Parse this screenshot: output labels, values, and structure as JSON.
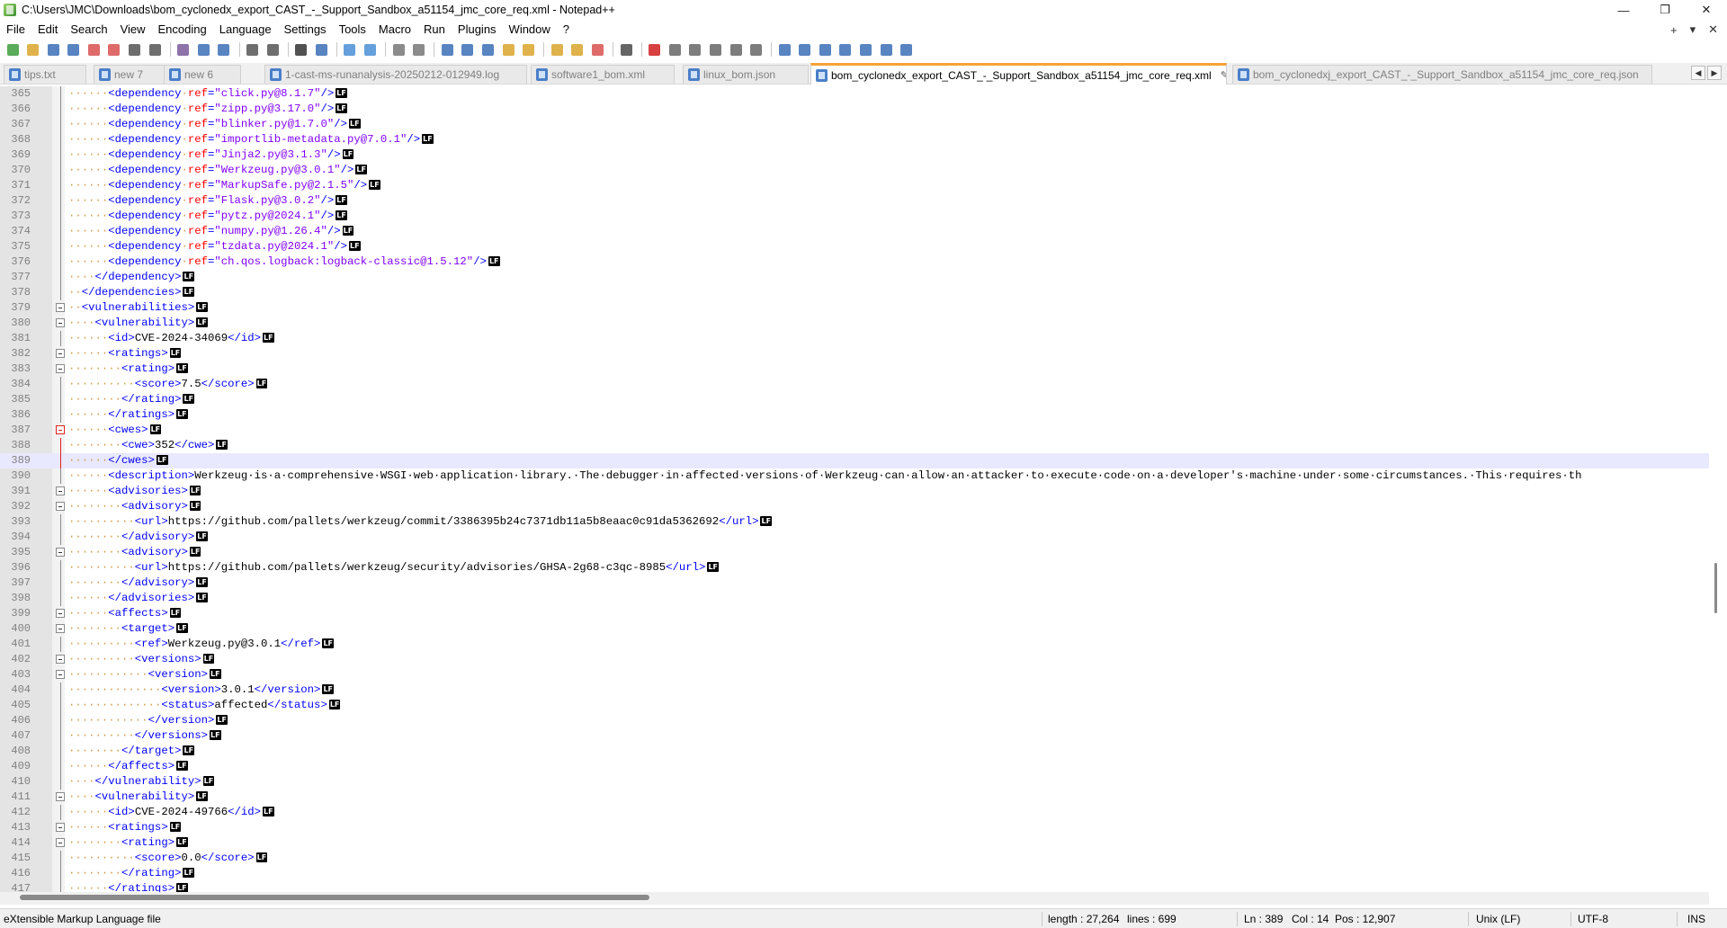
{
  "window": {
    "title": "C:\\Users\\JMC\\Downloads\\bom_cyclonedx_export_CAST_-_Support_Sandbox_a51154_jmc_core_req.xml - Notepad++",
    "minimize": "—",
    "maximize": "❐",
    "close": "✕"
  },
  "menu": {
    "items": [
      "File",
      "Edit",
      "Search",
      "View",
      "Encoding",
      "Language",
      "Settings",
      "Tools",
      "Macro",
      "Run",
      "Plugins",
      "Window",
      "?"
    ],
    "right_controls": [
      "+",
      "▾",
      "✕"
    ]
  },
  "toolbar": {
    "icons": [
      "new-file",
      "open-file",
      "save",
      "save-all",
      "close",
      "close-all",
      "print",
      "print-now",
      "cut",
      "copy",
      "paste",
      "undo",
      "redo",
      "find",
      "replace",
      "zoom-in",
      "zoom-out",
      "sync-vertical",
      "sync-horizontal",
      "word-wrap",
      "show-all-chars",
      "indent-guide",
      "udl",
      "doc-map",
      "function-list",
      "folder-as-workspace",
      "doc-switcher",
      "monitoring",
      "record-macro",
      "stop-record",
      "play-macro",
      "run-macro-multiple",
      "save-macro",
      "spell-check",
      "compare",
      "compare-prev",
      "compare-next",
      "compare-first",
      "compare-last",
      "compare-settings",
      "xml-tools"
    ]
  },
  "tabs": [
    {
      "label": "tips.txt",
      "active": false
    },
    {
      "label": "new 7",
      "active": false
    },
    {
      "label": "new 6",
      "active": false
    },
    {
      "label": "1-cast-ms-runanalysis-20250212-012949.log",
      "active": false
    },
    {
      "label": "software1_bom.xml",
      "active": false
    },
    {
      "label": "linux_bom.json",
      "active": false
    },
    {
      "label": "bom_cyclonedx_export_CAST_-_Support_Sandbox_a51154_jmc_core_req.xml",
      "active": true
    },
    {
      "label": "bom_cyclonedxj_export_CAST_-_Support_Sandbox_a51154_jmc_core_req.json",
      "active": false
    }
  ],
  "editor": {
    "current_line": 389,
    "lines": [
      {
        "n": 365,
        "fold": "line",
        "seg": [
          [
            "dots",
            "······"
          ],
          [
            "tag",
            "<dependency"
          ],
          [
            "dots",
            "·"
          ],
          [
            "attr",
            "ref"
          ],
          [
            "tag",
            "="
          ],
          [
            "val",
            "\"click.py@8.1.7\""
          ],
          [
            "tag",
            "/>"
          ]
        ]
      },
      {
        "n": 366,
        "fold": "line",
        "seg": [
          [
            "dots",
            "······"
          ],
          [
            "tag",
            "<dependency"
          ],
          [
            "dots",
            "·"
          ],
          [
            "attr",
            "ref"
          ],
          [
            "tag",
            "="
          ],
          [
            "val",
            "\"zipp.py@3.17.0\""
          ],
          [
            "tag",
            "/>"
          ]
        ]
      },
      {
        "n": 367,
        "fold": "line",
        "seg": [
          [
            "dots",
            "······"
          ],
          [
            "tag",
            "<dependency"
          ],
          [
            "dots",
            "·"
          ],
          [
            "attr",
            "ref"
          ],
          [
            "tag",
            "="
          ],
          [
            "val",
            "\"blinker.py@1.7.0\""
          ],
          [
            "tag",
            "/>"
          ]
        ]
      },
      {
        "n": 368,
        "fold": "line",
        "seg": [
          [
            "dots",
            "······"
          ],
          [
            "tag",
            "<dependency"
          ],
          [
            "dots",
            "·"
          ],
          [
            "attr",
            "ref"
          ],
          [
            "tag",
            "="
          ],
          [
            "val",
            "\"importlib-metadata.py@7.0.1\""
          ],
          [
            "tag",
            "/>"
          ]
        ]
      },
      {
        "n": 369,
        "fold": "line",
        "seg": [
          [
            "dots",
            "······"
          ],
          [
            "tag",
            "<dependency"
          ],
          [
            "dots",
            "·"
          ],
          [
            "attr",
            "ref"
          ],
          [
            "tag",
            "="
          ],
          [
            "val",
            "\"Jinja2.py@3.1.3\""
          ],
          [
            "tag",
            "/>"
          ]
        ]
      },
      {
        "n": 370,
        "fold": "line",
        "seg": [
          [
            "dots",
            "······"
          ],
          [
            "tag",
            "<dependency"
          ],
          [
            "dots",
            "·"
          ],
          [
            "attr",
            "ref"
          ],
          [
            "tag",
            "="
          ],
          [
            "val",
            "\"Werkzeug.py@3.0.1\""
          ],
          [
            "tag",
            "/>"
          ]
        ]
      },
      {
        "n": 371,
        "fold": "line",
        "seg": [
          [
            "dots",
            "······"
          ],
          [
            "tag",
            "<dependency"
          ],
          [
            "dots",
            "·"
          ],
          [
            "attr",
            "ref"
          ],
          [
            "tag",
            "="
          ],
          [
            "val",
            "\"MarkupSafe.py@2.1.5\""
          ],
          [
            "tag",
            "/>"
          ]
        ]
      },
      {
        "n": 372,
        "fold": "line",
        "seg": [
          [
            "dots",
            "······"
          ],
          [
            "tag",
            "<dependency"
          ],
          [
            "dots",
            "·"
          ],
          [
            "attr",
            "ref"
          ],
          [
            "tag",
            "="
          ],
          [
            "val",
            "\"Flask.py@3.0.2\""
          ],
          [
            "tag",
            "/>"
          ]
        ]
      },
      {
        "n": 373,
        "fold": "line",
        "seg": [
          [
            "dots",
            "······"
          ],
          [
            "tag",
            "<dependency"
          ],
          [
            "dots",
            "·"
          ],
          [
            "attr",
            "ref"
          ],
          [
            "tag",
            "="
          ],
          [
            "val",
            "\"pytz.py@2024.1\""
          ],
          [
            "tag",
            "/>"
          ]
        ]
      },
      {
        "n": 374,
        "fold": "line",
        "seg": [
          [
            "dots",
            "······"
          ],
          [
            "tag",
            "<dependency"
          ],
          [
            "dots",
            "·"
          ],
          [
            "attr",
            "ref"
          ],
          [
            "tag",
            "="
          ],
          [
            "val",
            "\"numpy.py@1.26.4\""
          ],
          [
            "tag",
            "/>"
          ]
        ]
      },
      {
        "n": 375,
        "fold": "line",
        "seg": [
          [
            "dots",
            "······"
          ],
          [
            "tag",
            "<dependency"
          ],
          [
            "dots",
            "·"
          ],
          [
            "attr",
            "ref"
          ],
          [
            "tag",
            "="
          ],
          [
            "val",
            "\"tzdata.py@2024.1\""
          ],
          [
            "tag",
            "/>"
          ]
        ]
      },
      {
        "n": 376,
        "fold": "line",
        "seg": [
          [
            "dots",
            "······"
          ],
          [
            "tag",
            "<dependency"
          ],
          [
            "dots",
            "·"
          ],
          [
            "attr",
            "ref"
          ],
          [
            "tag",
            "="
          ],
          [
            "val",
            "\"ch.qos.logback:logback-classic@1.5.12\""
          ],
          [
            "tag",
            "/>"
          ]
        ]
      },
      {
        "n": 377,
        "fold": "line",
        "seg": [
          [
            "dots",
            "····"
          ],
          [
            "tag",
            "</dependency>"
          ]
        ]
      },
      {
        "n": 378,
        "fold": "line",
        "seg": [
          [
            "dots",
            "··"
          ],
          [
            "tag",
            "</dependencies>"
          ]
        ]
      },
      {
        "n": 379,
        "fold": "box",
        "seg": [
          [
            "dots",
            "··"
          ],
          [
            "tag",
            "<vulnerabilities>"
          ]
        ]
      },
      {
        "n": 380,
        "fold": "box",
        "seg": [
          [
            "dots",
            "····"
          ],
          [
            "tag",
            "<vulnerability>"
          ]
        ]
      },
      {
        "n": 381,
        "fold": "line",
        "seg": [
          [
            "dots",
            "······"
          ],
          [
            "tag",
            "<id>"
          ],
          [
            "txt",
            "CVE-2024-34069"
          ],
          [
            "tag",
            "</id>"
          ]
        ]
      },
      {
        "n": 382,
        "fold": "box",
        "seg": [
          [
            "dots",
            "······"
          ],
          [
            "tag",
            "<ratings>"
          ]
        ]
      },
      {
        "n": 383,
        "fold": "box",
        "seg": [
          [
            "dots",
            "········"
          ],
          [
            "tag",
            "<rating>"
          ]
        ]
      },
      {
        "n": 384,
        "fold": "line",
        "seg": [
          [
            "dots",
            "··········"
          ],
          [
            "tag",
            "<score>"
          ],
          [
            "txt",
            "7.5"
          ],
          [
            "tag",
            "</score>"
          ]
        ]
      },
      {
        "n": 385,
        "fold": "line",
        "seg": [
          [
            "dots",
            "········"
          ],
          [
            "tag",
            "</rating>"
          ]
        ]
      },
      {
        "n": 386,
        "fold": "line",
        "seg": [
          [
            "dots",
            "······"
          ],
          [
            "tag",
            "</ratings>"
          ]
        ]
      },
      {
        "n": 387,
        "fold": "redbox",
        "seg": [
          [
            "dots",
            "······"
          ],
          [
            "tag",
            "<cwes>"
          ]
        ]
      },
      {
        "n": 388,
        "fold": "redline",
        "seg": [
          [
            "dots",
            "········"
          ],
          [
            "tag",
            "<cwe>"
          ],
          [
            "txt",
            "352"
          ],
          [
            "tag",
            "</cwe>"
          ]
        ]
      },
      {
        "n": 389,
        "fold": "redline",
        "seg": [
          [
            "dots",
            "······"
          ],
          [
            "tag",
            "</cwes>"
          ]
        ]
      },
      {
        "n": 390,
        "fold": "line",
        "nolf": true,
        "seg": [
          [
            "dots",
            "······"
          ],
          [
            "tag",
            "<description>"
          ],
          [
            "txt",
            "Werkzeug·is·a·comprehensive·WSGI·web·application·library.·The·debugger·in·affected·versions·of·Werkzeug·can·allow·an·attacker·to·execute·code·on·a·developer's·machine·under·some·circumstances.·This·requires·th"
          ]
        ]
      },
      {
        "n": 391,
        "fold": "box",
        "seg": [
          [
            "dots",
            "······"
          ],
          [
            "tag",
            "<advisories>"
          ]
        ]
      },
      {
        "n": 392,
        "fold": "box",
        "seg": [
          [
            "dots",
            "········"
          ],
          [
            "tag",
            "<advisory>"
          ]
        ]
      },
      {
        "n": 393,
        "fold": "line",
        "seg": [
          [
            "dots",
            "··········"
          ],
          [
            "tag",
            "<url>"
          ],
          [
            "txt",
            "https://github.com/pallets/werkzeug/commit/3386395b24c7371db11a5b8eaac0c91da5362692"
          ],
          [
            "tag",
            "</url>"
          ]
        ]
      },
      {
        "n": 394,
        "fold": "line",
        "seg": [
          [
            "dots",
            "········"
          ],
          [
            "tag",
            "</advisory>"
          ]
        ]
      },
      {
        "n": 395,
        "fold": "box",
        "seg": [
          [
            "dots",
            "········"
          ],
          [
            "tag",
            "<advisory>"
          ]
        ]
      },
      {
        "n": 396,
        "fold": "line",
        "seg": [
          [
            "dots",
            "··········"
          ],
          [
            "tag",
            "<url>"
          ],
          [
            "txt",
            "https://github.com/pallets/werkzeug/security/advisories/GHSA-2g68-c3qc-8985"
          ],
          [
            "tag",
            "</url>"
          ]
        ]
      },
      {
        "n": 397,
        "fold": "line",
        "seg": [
          [
            "dots",
            "········"
          ],
          [
            "tag",
            "</advisory>"
          ]
        ]
      },
      {
        "n": 398,
        "fold": "line",
        "seg": [
          [
            "dots",
            "······"
          ],
          [
            "tag",
            "</advisories>"
          ]
        ]
      },
      {
        "n": 399,
        "fold": "box",
        "seg": [
          [
            "dots",
            "······"
          ],
          [
            "tag",
            "<affects>"
          ]
        ]
      },
      {
        "n": 400,
        "fold": "box",
        "seg": [
          [
            "dots",
            "········"
          ],
          [
            "tag",
            "<target>"
          ]
        ]
      },
      {
        "n": 401,
        "fold": "line",
        "seg": [
          [
            "dots",
            "··········"
          ],
          [
            "tag",
            "<ref>"
          ],
          [
            "txt",
            "Werkzeug.py@3.0.1"
          ],
          [
            "tag",
            "</ref>"
          ]
        ]
      },
      {
        "n": 402,
        "fold": "box",
        "seg": [
          [
            "dots",
            "··········"
          ],
          [
            "tag",
            "<versions>"
          ]
        ]
      },
      {
        "n": 403,
        "fold": "box",
        "seg": [
          [
            "dots",
            "············"
          ],
          [
            "tag",
            "<version>"
          ]
        ]
      },
      {
        "n": 404,
        "fold": "line",
        "seg": [
          [
            "dots",
            "··············"
          ],
          [
            "tag",
            "<version>"
          ],
          [
            "txt",
            "3.0.1"
          ],
          [
            "tag",
            "</version>"
          ]
        ]
      },
      {
        "n": 405,
        "fold": "line",
        "seg": [
          [
            "dots",
            "··············"
          ],
          [
            "tag",
            "<status>"
          ],
          [
            "txt",
            "affected"
          ],
          [
            "tag",
            "</status>"
          ]
        ]
      },
      {
        "n": 406,
        "fold": "line",
        "seg": [
          [
            "dots",
            "············"
          ],
          [
            "tag",
            "</version>"
          ]
        ]
      },
      {
        "n": 407,
        "fold": "line",
        "seg": [
          [
            "dots",
            "··········"
          ],
          [
            "tag",
            "</versions>"
          ]
        ]
      },
      {
        "n": 408,
        "fold": "line",
        "seg": [
          [
            "dots",
            "········"
          ],
          [
            "tag",
            "</target>"
          ]
        ]
      },
      {
        "n": 409,
        "fold": "line",
        "seg": [
          [
            "dots",
            "······"
          ],
          [
            "tag",
            "</affects>"
          ]
        ]
      },
      {
        "n": 410,
        "fold": "line",
        "seg": [
          [
            "dots",
            "····"
          ],
          [
            "tag",
            "</vulnerability>"
          ]
        ]
      },
      {
        "n": 411,
        "fold": "box",
        "seg": [
          [
            "dots",
            "····"
          ],
          [
            "tag",
            "<vulnerability>"
          ]
        ]
      },
      {
        "n": 412,
        "fold": "line",
        "seg": [
          [
            "dots",
            "······"
          ],
          [
            "tag",
            "<id>"
          ],
          [
            "txt",
            "CVE-2024-49766"
          ],
          [
            "tag",
            "</id>"
          ]
        ]
      },
      {
        "n": 413,
        "fold": "box",
        "seg": [
          [
            "dots",
            "······"
          ],
          [
            "tag",
            "<ratings>"
          ]
        ]
      },
      {
        "n": 414,
        "fold": "box",
        "seg": [
          [
            "dots",
            "········"
          ],
          [
            "tag",
            "<rating>"
          ]
        ]
      },
      {
        "n": 415,
        "fold": "line",
        "seg": [
          [
            "dots",
            "··········"
          ],
          [
            "tag",
            "<score>"
          ],
          [
            "txt",
            "0.0"
          ],
          [
            "tag",
            "</score>"
          ]
        ]
      },
      {
        "n": 416,
        "fold": "line",
        "seg": [
          [
            "dots",
            "········"
          ],
          [
            "tag",
            "</rating>"
          ]
        ]
      },
      {
        "n": 417,
        "fold": "line",
        "seg": [
          [
            "dots",
            "······"
          ],
          [
            "tag",
            "</ratings>"
          ]
        ]
      }
    ]
  },
  "statusbar": {
    "file_type": "eXtensible Markup Language file",
    "length": "length : 27,264",
    "lines": "lines : 699",
    "ln": "Ln : 389",
    "col": "Col : 14",
    "pos": "Pos : 12,907",
    "eol": "Unix (LF)",
    "encoding": "UTF-8",
    "mode": "INS"
  }
}
